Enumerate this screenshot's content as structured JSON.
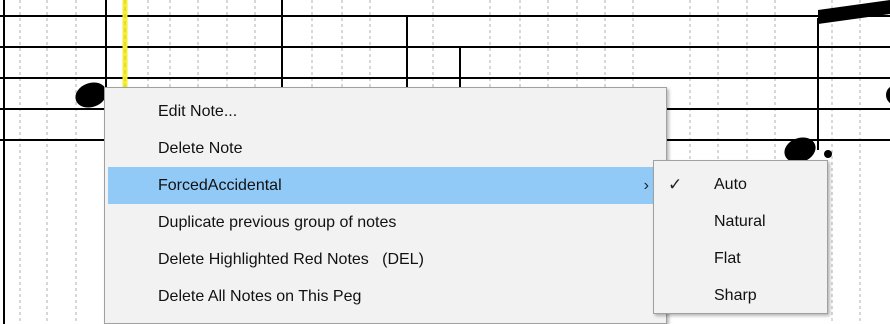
{
  "context_menu": {
    "items": [
      {
        "label": "Edit Note..."
      },
      {
        "label": "Delete Note"
      },
      {
        "label": "ForcedAccidental",
        "submenu_arrow": "›"
      },
      {
        "label": "Duplicate previous group of notes"
      },
      {
        "label": "Delete Highlighted Red Notes   (DEL)"
      },
      {
        "label": "Delete All Notes on This Peg"
      }
    ],
    "highlight_color": "#91c9f7"
  },
  "accidental_submenu": {
    "items": [
      {
        "label": "Auto",
        "check": "✓"
      },
      {
        "label": "Natural"
      },
      {
        "label": "Flat"
      },
      {
        "label": "Sharp"
      }
    ]
  },
  "colors": {
    "playback_cursor": "#f2ee3a",
    "staff_line": "#000000",
    "grid_line": "#b0b0b0"
  }
}
